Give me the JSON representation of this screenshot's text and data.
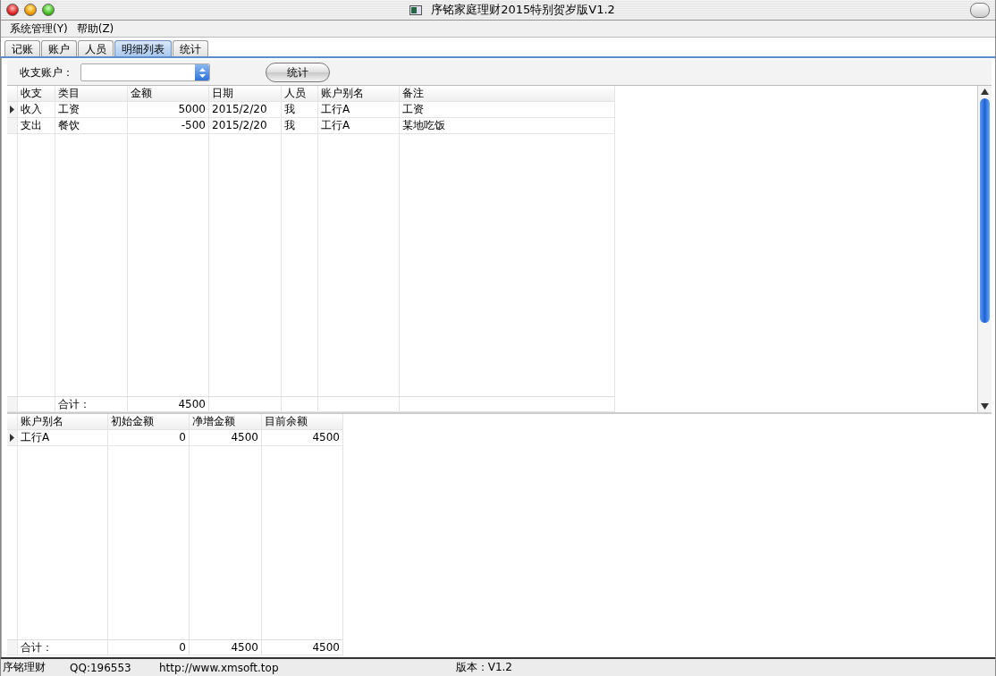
{
  "window": {
    "title": "序铭家庭理财2015特别贺岁版V1.2"
  },
  "menu": [
    "系统管理(Y)",
    "帮助(Z)"
  ],
  "tabs": [
    {
      "label": "记账",
      "selected": false
    },
    {
      "label": "账户",
      "selected": false
    },
    {
      "label": "人员",
      "selected": false
    },
    {
      "label": "明细列表",
      "selected": true
    },
    {
      "label": "统计",
      "selected": false
    }
  ],
  "filter": {
    "label": "收支账户："
  },
  "stat_button": "统计",
  "detail_table": {
    "columns": [
      "收支",
      "类目",
      "金额",
      "日期",
      "人员",
      "账户别名",
      "备注"
    ],
    "rows": [
      {
        "current": true,
        "cells": [
          "收入",
          "工资",
          "5000",
          "2015/2/20",
          "我",
          "工行A",
          "工资"
        ]
      },
      {
        "current": false,
        "cells": [
          "支出",
          "餐饮",
          "-500",
          "2015/2/20",
          "我",
          "工行A",
          "某地吃饭"
        ]
      }
    ],
    "footer": {
      "label": "合计：",
      "amount": "4500"
    }
  },
  "account_table": {
    "columns": [
      "账户别名",
      "初始金额",
      "净增金额",
      "目前余额"
    ],
    "rows": [
      {
        "current": true,
        "cells": [
          "工行A",
          "0",
          "4500",
          "4500"
        ]
      }
    ],
    "footer": {
      "label": "合计：",
      "values": [
        "0",
        "4500",
        "4500"
      ]
    }
  },
  "status_bar": [
    "序铭理财",
    "QQ:196553",
    "http://www.xmsoft.top",
    "版本：V1.2"
  ]
}
